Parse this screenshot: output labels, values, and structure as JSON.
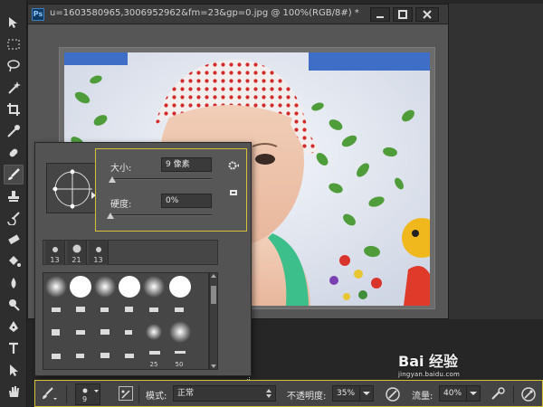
{
  "document": {
    "app_badge": "Ps",
    "title": "u=1603580965,3006952962&fm=23&gp=0.jpg @ 100%(RGB/8#) *",
    "window_buttons": [
      "minimize",
      "maximize",
      "close"
    ]
  },
  "brush_picker": {
    "size_label": "大小:",
    "size_value": "9 像素",
    "hardness_label": "硬度:",
    "hardness_value": "0%",
    "size_slider_fraction": 0.02,
    "hardness_slider_fraction": 0.0,
    "recent_brushes": [
      "13",
      "21",
      "13"
    ],
    "preset_labels": [
      "25",
      "50"
    ]
  },
  "options_bar": {
    "brush_size": "9",
    "mode_label": "模式:",
    "mode_value": "正常",
    "opacity_label": "不透明度:",
    "opacity_value": "35%",
    "flow_label": "流量:",
    "flow_value": "40%"
  },
  "watermark": {
    "text": "Bai 经验",
    "domain": "jingyan.baidu.com"
  },
  "colors": {
    "highlight": "#d8c13a",
    "panel": "#535353",
    "dark": "#262626"
  }
}
